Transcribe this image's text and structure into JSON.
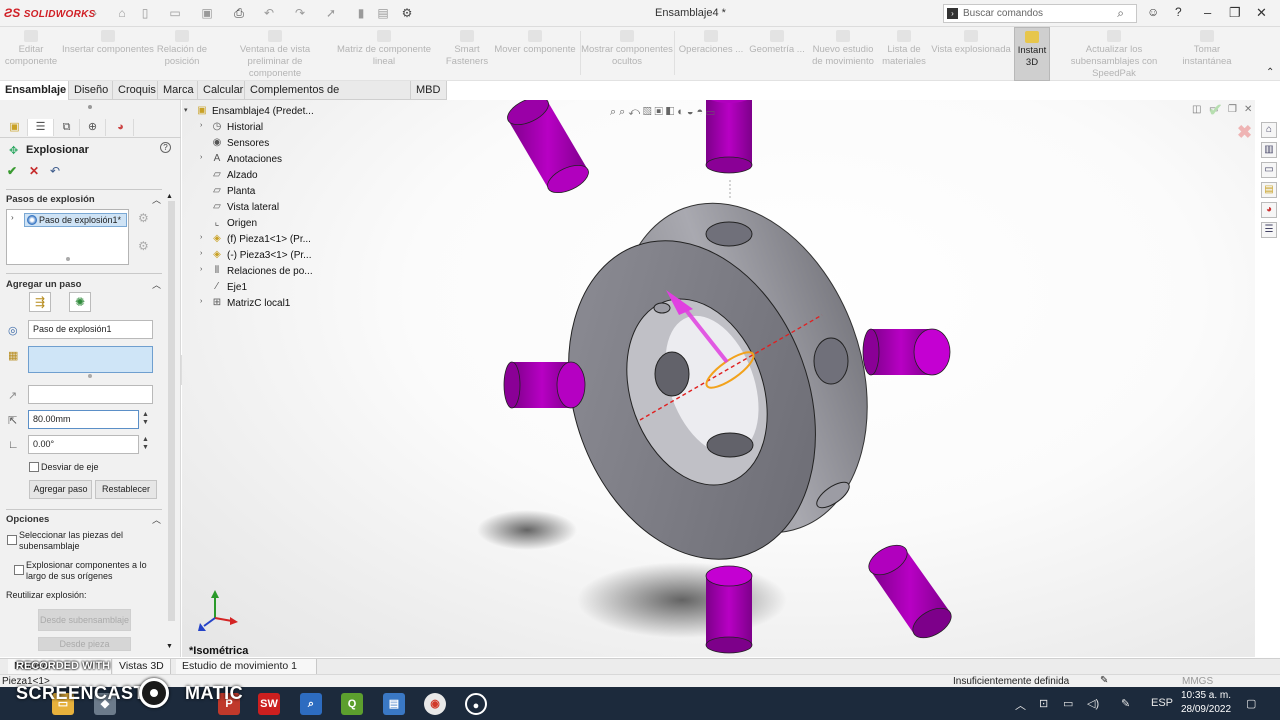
{
  "titlebar": {
    "logo": "SOLIDWORKS",
    "document": "Ensamblaje4 *",
    "search_placeholder": "Buscar comandos"
  },
  "command_manager": {
    "buttons": [
      "Editar componente",
      "Insertar componentes",
      "Relación de posición",
      "Ventana de vista preliminar de componente",
      "Matriz de componente lineal",
      "Smart Fasteners",
      "Mover componente",
      "Mostrar componentes ocultos",
      "Operaciones ...",
      "Geometría ...",
      "Nuevo estudio de movimiento",
      "Lista de materiales",
      "Vista explosionada",
      "Instant 3D",
      "Actualizar los subensamblajes con SpeedPak",
      "Tomar instantánea"
    ]
  },
  "tabs": [
    "Ensamblaje",
    "Diseño",
    "Croquis",
    "Marca",
    "Calcular",
    "Complementos de SOLIDWORKS",
    "MBD"
  ],
  "property_manager": {
    "title": "Explosionar",
    "help": "?",
    "steps_group": "Pasos de explosión",
    "step_item": "Paso de explosión1*",
    "add_step_group": "Agregar un paso",
    "step_name": "Paso de explosión1",
    "distance": "80.00mm",
    "angle": "0.00°",
    "deviate_axis": "Desviar de eje",
    "add_step_btn": "Agregar paso",
    "reset_btn": "Restablecer",
    "options_group": "Opciones",
    "opt_select_parts": "Seleccionar las piezas del subensamblaje",
    "opt_explode_origin": "Explosionar componentes a lo largo de sus orígenes",
    "reuse_explode": "Reutilizar explosión:",
    "from_subassembly": "Desde subensamblaje",
    "from_part": "Desde pieza"
  },
  "tree": {
    "root": "Ensamblaje4 (Predet...",
    "items": [
      "Historial",
      "Sensores",
      "Anotaciones",
      "Alzado",
      "Planta",
      "Vista lateral",
      "Origen",
      "(f) Pieza1<1> (Pr...",
      "(-) Pieza3<1> (Pr...",
      "Relaciones de po...",
      "Eje1",
      "MatrizC local1"
    ]
  },
  "viewport": {
    "view_name": "*Isométrica"
  },
  "bottom_tabs": [
    "Modelo",
    "Vistas 3D",
    "Estudio de movimiento 1"
  ],
  "status": {
    "left": "Pieza1<1>",
    "definition": "Insuficientemente definida",
    "units": "MMGS"
  },
  "watermark": {
    "top": "RECORDED WITH",
    "main_left": "SCREENCAST",
    "main_right": "MATIC"
  },
  "taskbar": {
    "lang": "ESP",
    "time": "10:35 a. m.",
    "date": "28/09/2022"
  },
  "colors": {
    "pin": "#a800b5",
    "ring": "#8c8c92",
    "brand": "#d01f25",
    "taskbar": "#1c2a3c"
  }
}
